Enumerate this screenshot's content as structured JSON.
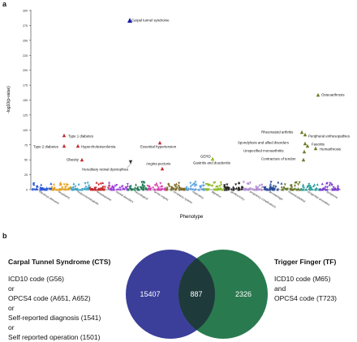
{
  "panel_a": {
    "label": "a",
    "chart_data": {
      "type": "scatter",
      "ylabel": "-log10(p-value)",
      "xlabel": "Phenotype",
      "ylim": [
        0,
        300
      ],
      "yticks": [
        0,
        25,
        50,
        75,
        100,
        125,
        150,
        175,
        200,
        225,
        250,
        275,
        300
      ],
      "categories": [
        "infectious diseases",
        "neoplasms",
        "endocrine/metabolic",
        "hematopoietic",
        "mental disorders",
        "neurological",
        "sense organs",
        "circulatory system",
        "respiratory",
        "digestive",
        "genitourinary",
        "pregnancy complications",
        "dermatologic",
        "musculoskeletal",
        "congenital anomalies",
        "symptoms"
      ],
      "category_colors": [
        "#2f5bd8",
        "#e8a21a",
        "#3aa6c8",
        "#c8282d",
        "#9a3ee0",
        "#1a7a50",
        "#d83fb0",
        "#7a6a20",
        "#5aa0e0",
        "#8fbf2a",
        "#222222",
        "#b08ad0",
        "#2a4a9a",
        "#6a7a2a",
        "#2aa0a0",
        "#7a3ad0"
      ],
      "annotations": [
        {
          "text": "Carpal tunnel syndrome",
          "category": 5,
          "y": 296,
          "color": "#1a1aa8",
          "marker": "triangle-up"
        },
        {
          "text": "Osteoarthrosis",
          "category": 13,
          "y": 166,
          "color": "#6a7a2a",
          "marker": "triangle-up"
        },
        {
          "text": "Type 1 diabetes",
          "category": 2,
          "y": 91,
          "color": "#c8282d",
          "marker": "triangle-up"
        },
        {
          "text": "Type 2 diabetes",
          "category": 2,
          "y": 76,
          "color": "#c8282d",
          "marker": "triangle-up"
        },
        {
          "text": "Hypercholesterolemia",
          "category": 2,
          "y": 73,
          "color": "#c8282d",
          "marker": "triangle-up"
        },
        {
          "text": "Obesity",
          "category": 2,
          "y": 51,
          "color": "#c8282d",
          "marker": "triangle-up"
        },
        {
          "text": "Hereditary retinal dystrophies",
          "category": 6,
          "y": 43,
          "color": "#2f2f2f",
          "marker": "triangle-down"
        },
        {
          "text": "Essential hypertension",
          "category": 7,
          "y": 80,
          "color": "#c8282d",
          "marker": "triangle-up"
        },
        {
          "text": "Angina pectoris",
          "category": 7,
          "y": 36,
          "color": "#c8282d",
          "marker": "triangle-up"
        },
        {
          "text": "GERD",
          "category": 9,
          "y": 53,
          "color": "#8fbf2a",
          "marker": "triangle-up"
        },
        {
          "text": "Gastritis and duodenitis",
          "category": 9,
          "y": 47,
          "color": "#8fbf2a",
          "marker": "triangle-up"
        },
        {
          "text": "Rheumatoid arthritis",
          "category": 13,
          "y": 94,
          "color": "#6a7a2a",
          "marker": "triangle-up"
        },
        {
          "text": "Peripheral enthesopathies",
          "category": 13,
          "y": 89,
          "color": "#6a7a2a",
          "marker": "triangle-up"
        },
        {
          "text": "Spondylosis and allied disorders",
          "category": 13,
          "y": 76,
          "color": "#6a7a2a",
          "marker": "triangle-up"
        },
        {
          "text": "Fasciitis",
          "category": 13,
          "y": 72,
          "color": "#6a7a2a",
          "marker": "triangle-up"
        },
        {
          "text": "Unspecified monoarthritis",
          "category": 13,
          "y": 66,
          "color": "#6a7a2a",
          "marker": "triangle-up"
        },
        {
          "text": "Hemarthrosis",
          "category": 13,
          "y": 65,
          "color": "#6a7a2a",
          "marker": "triangle-up"
        },
        {
          "text": "Contracture of tendon",
          "category": 13,
          "y": 51,
          "color": "#6a7a2a",
          "marker": "triangle-up"
        }
      ]
    }
  },
  "panel_b": {
    "label": "b",
    "cts": {
      "title": "Carpal Tunnel Syndrome (CTS)",
      "lines": [
        "ICD10 code (G56)",
        "or",
        "OPCS4 code (A651, A652)",
        "or",
        "Self-reported diagnosis (1541)",
        "or",
        "Self reported operation (1501)"
      ]
    },
    "tf": {
      "title": "Trigger Finger (TF)",
      "lines": [
        "ICD10 code (M65)",
        "and",
        "OPCS4 code (T723)"
      ]
    },
    "venn": {
      "left_only": "15407",
      "overlap": "887",
      "right_only": "2326",
      "left_color": "#3b3f9a",
      "right_color": "#2a7a50",
      "overlap_color": "#1f3a3a"
    }
  }
}
